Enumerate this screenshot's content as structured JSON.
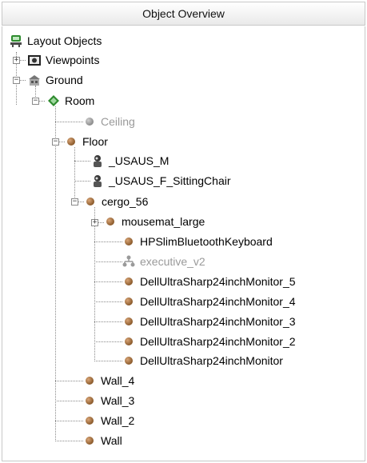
{
  "panel": {
    "title": "Object Overview"
  },
  "tree": {
    "root": {
      "label": "Layout Objects",
      "icon": "layout-objects-icon"
    },
    "viewpoints": {
      "label": "Viewpoints",
      "icon": "viewpoints-camera-icon",
      "expanded": false
    },
    "ground": {
      "label": "Ground",
      "icon": "ground-building-icon",
      "expanded": true
    },
    "room": {
      "label": "Room",
      "icon": "room-diamond-icon",
      "expanded": true
    },
    "ceiling": {
      "label": "Ceiling",
      "icon": "sphere-icon",
      "disabled": true
    },
    "floor": {
      "label": "Floor",
      "icon": "sphere-icon",
      "expanded": true
    },
    "avatar_m": {
      "label": "_USAUS_M",
      "icon": "avatar-icon"
    },
    "avatar_f": {
      "label": "_USAUS_F_SittingChair",
      "icon": "avatar-icon"
    },
    "cergo": {
      "label": "cergo_56",
      "icon": "sphere-icon",
      "expanded": true
    },
    "mousemat": {
      "label": "mousemat_large",
      "icon": "sphere-icon",
      "expanded": false
    },
    "keyboard": {
      "label": "HPSlimBluetoothKeyboard",
      "icon": "sphere-icon"
    },
    "executive": {
      "label": "executive_v2",
      "icon": "hierarchy-icon",
      "disabled": true
    },
    "monitor5": {
      "label": "DellUltraSharp24inchMonitor_5",
      "icon": "sphere-icon"
    },
    "monitor4": {
      "label": "DellUltraSharp24inchMonitor_4",
      "icon": "sphere-icon"
    },
    "monitor3": {
      "label": "DellUltraSharp24inchMonitor_3",
      "icon": "sphere-icon"
    },
    "monitor2": {
      "label": "DellUltraSharp24inchMonitor_2",
      "icon": "sphere-icon"
    },
    "monitor1": {
      "label": "DellUltraSharp24inchMonitor",
      "icon": "sphere-icon"
    },
    "wall4": {
      "label": "Wall_4",
      "icon": "sphere-icon"
    },
    "wall3": {
      "label": "Wall_3",
      "icon": "sphere-icon"
    },
    "wall2": {
      "label": "Wall_2",
      "icon": "sphere-icon"
    },
    "wall1": {
      "label": "Wall",
      "icon": "sphere-icon"
    }
  },
  "colors": {
    "sphere": "#8b5a2b",
    "disabled": "#9a9a9a",
    "room_icon": "#2e8b2e"
  }
}
